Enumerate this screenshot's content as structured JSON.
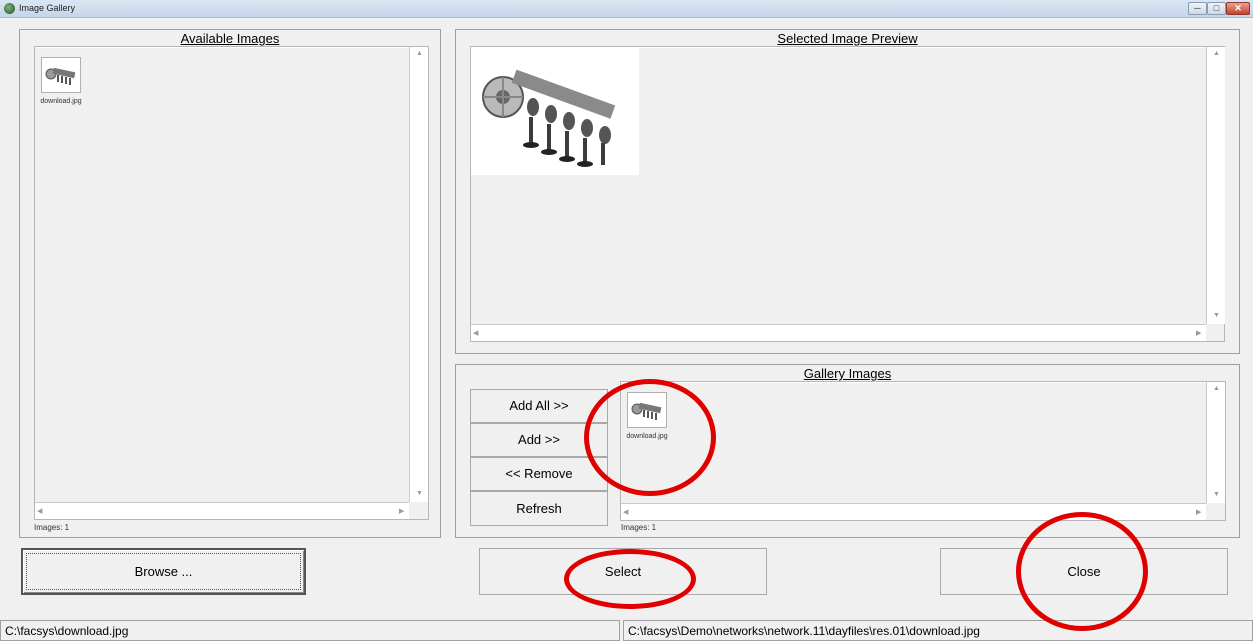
{
  "window": {
    "title": "Image Gallery",
    "controls": {
      "minimize": "─",
      "maximize": "□",
      "close": "✕"
    }
  },
  "available_images": {
    "title": "Available Images",
    "items": [
      {
        "filename": "download.jpg",
        "icon": "camshaft-thumbnail-icon"
      }
    ],
    "count_label": "Images: 1"
  },
  "preview": {
    "title": "Selected Image Preview",
    "image_icon": "camshaft-image-icon"
  },
  "gallery_images": {
    "title": "Gallery Images",
    "items": [
      {
        "filename": "download.jpg",
        "icon": "camshaft-thumbnail-icon"
      }
    ],
    "count_label": "Images: 1"
  },
  "transfer_buttons": {
    "add_all": "Add All >>",
    "add": "Add >>",
    "remove": "<< Remove",
    "refresh": "Refresh"
  },
  "actions": {
    "browse": "Browse ...",
    "select": "Select",
    "close": "Close"
  },
  "statusbar": {
    "left": "C:\\facsys\\download.jpg",
    "right": "C:\\facsys\\Demo\\networks\\network.11\\dayfiles\\res.01\\download.jpg"
  },
  "annotations": {
    "highlight_color": "#e00000"
  }
}
